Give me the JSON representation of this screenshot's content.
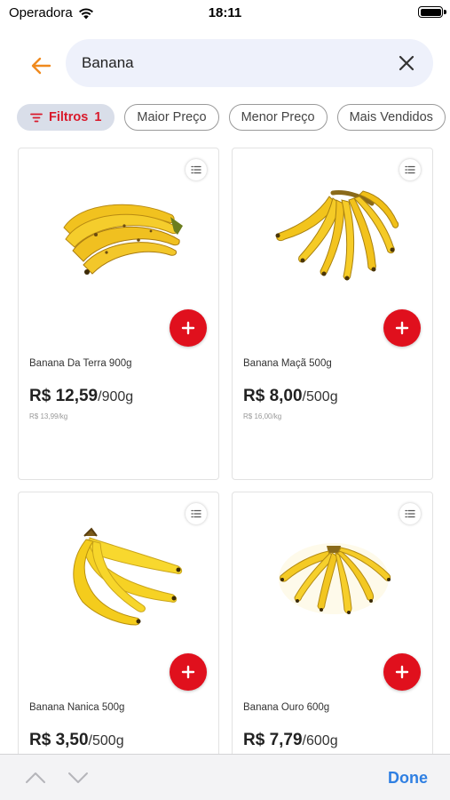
{
  "status_bar": {
    "carrier": "Operadora",
    "time": "18:11"
  },
  "search": {
    "value": "Banana",
    "back_icon": "arrow-left-icon",
    "clear_icon": "close-icon"
  },
  "filters": {
    "active_label": "Filtros",
    "active_count": "1",
    "chips": [
      "Maior Preço",
      "Menor Preço",
      "Mais Vendidos"
    ]
  },
  "products": [
    {
      "name": "Banana Da Terra 900g",
      "price": "R$ 12,59",
      "unit": "/900g",
      "price_per_kg": "R$ 13,99/kg"
    },
    {
      "name": "Banana Maçã 500g",
      "price": "R$ 8,00",
      "unit": "/500g",
      "price_per_kg": "R$ 16,00/kg"
    },
    {
      "name": "Banana Nanica 500g",
      "price": "R$ 3,50",
      "unit": "/500g",
      "price_per_kg": ""
    },
    {
      "name": "Banana Ouro 600g",
      "price": "R$ 7,79",
      "unit": "/600g",
      "price_per_kg": ""
    }
  ],
  "keyboard_bar": {
    "done_label": "Done"
  },
  "colors": {
    "accent_red": "#e0101d",
    "back_orange": "#f08a1e",
    "done_blue": "#2f7fe2",
    "search_bg": "#eef1fb"
  }
}
